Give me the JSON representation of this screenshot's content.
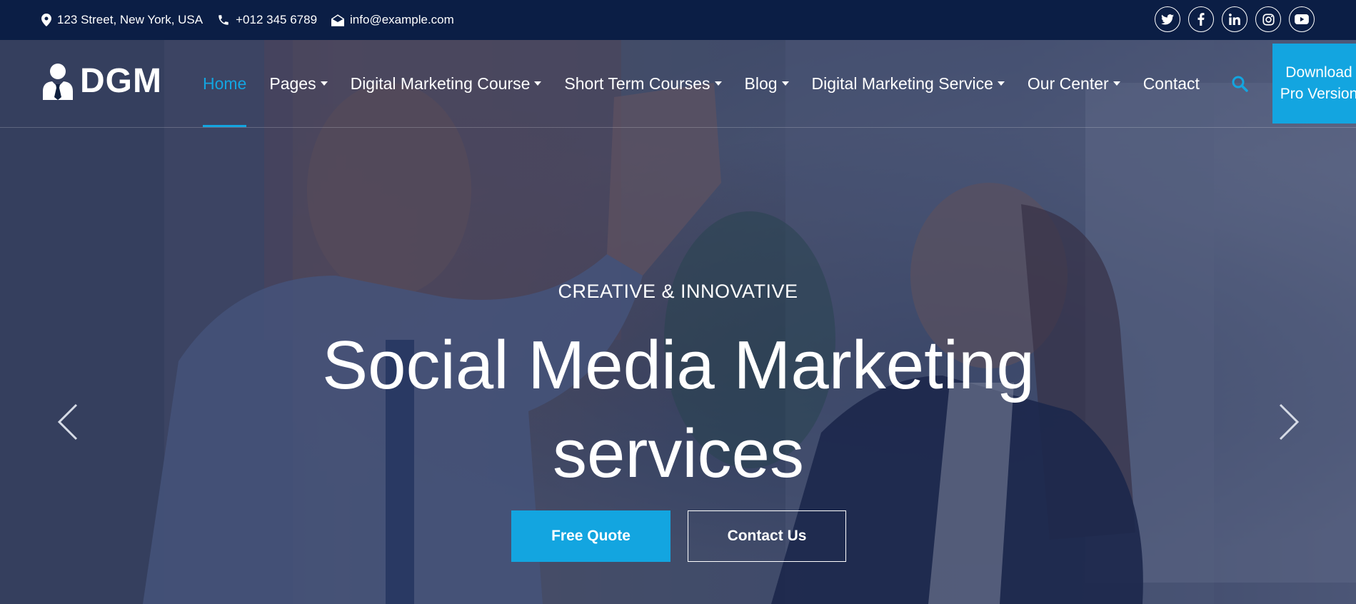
{
  "topbar": {
    "address": "123 Street, New York, USA",
    "phone": "+012 345 6789",
    "email": "info@example.com",
    "social": [
      "twitter-icon",
      "facebook-icon",
      "linkedin-icon",
      "instagram-icon",
      "youtube-icon"
    ]
  },
  "brand": {
    "name": "DGM"
  },
  "nav": {
    "items": [
      {
        "label": "Home",
        "active": true,
        "dropdown": false
      },
      {
        "label": "Pages",
        "dropdown": true
      },
      {
        "label": "Digital Marketing Course",
        "dropdown": true
      },
      {
        "label": "Short Term Courses",
        "dropdown": true
      },
      {
        "label": "Blog",
        "dropdown": true
      },
      {
        "label": "Digital Marketing Service",
        "dropdown": true
      },
      {
        "label": "Our Center",
        "dropdown": true
      },
      {
        "label": "Contact",
        "dropdown": false
      }
    ],
    "pro_button": "Download Pro Version"
  },
  "hero": {
    "tagline": "CREATIVE & INNOVATIVE",
    "headline": "Social Media Marketing services",
    "primary_button": "Free Quote",
    "secondary_button": "Contact Us"
  },
  "colors": {
    "accent": "#13a5e0",
    "topbar": "#0b1e45"
  }
}
